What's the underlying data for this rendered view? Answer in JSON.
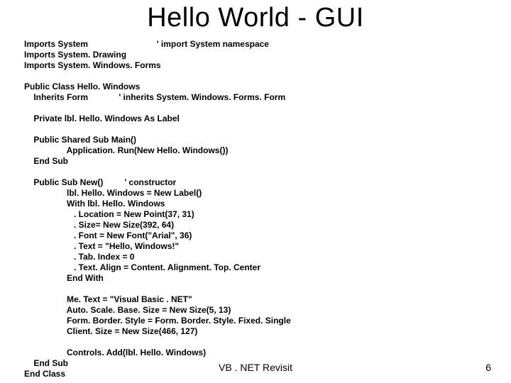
{
  "title": "Hello World - GUI",
  "code": "Imports System                             ' import System namespace\nImports System. Drawing\nImports System. Windows. Forms\n\nPublic Class Hello. Windows\n    Inherits Form             ' inherits System. Windows. Forms. Form\n\n    Private lbl. Hello. Windows As Label\n\n    Public Shared Sub Main()\n                  Application. Run(New Hello. Windows())\n    End Sub\n\n    Public Sub New()         ' constructor\n                  lbl. Hello. Windows = New Label()\n                  With lbl. Hello. Windows\n                     . Location = New Point(37, 31)\n                     . Size= New Size(392, 64)\n                     . Font = New Font(\"Arial\", 36)\n                     . Text = \"Hello, Windows!\"\n                     . Tab. Index = 0\n                     . Text. Align = Content. Alignment. Top. Center\n                  End With\n\n                  Me. Text = \"Visual Basic . NET\"\n                  Auto. Scale. Base. Size = New Size(5, 13)\n                  Form. Border. Style = Form. Border. Style. Fixed. Single\n                  Client. Size = New Size(466, 127)\n\n                  Controls. Add(lbl. Hello. Windows)\n    End Sub\nEnd Class",
  "footer": {
    "label": "VB . NET Revisit",
    "page": "6"
  }
}
